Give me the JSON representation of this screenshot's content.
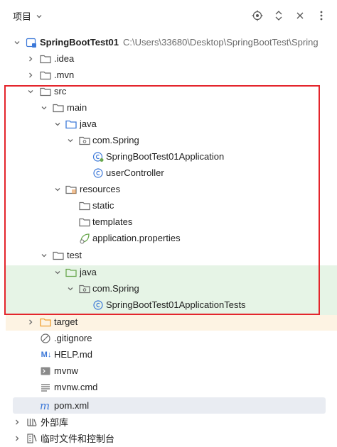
{
  "header": {
    "title": "项目",
    "icons": [
      "target-icon",
      "expand-collapse-icon",
      "close-icon",
      "more-icon"
    ]
  },
  "tree": [
    {
      "label": "SpringBootTest01",
      "path": "C:\\Users\\33680\\Desktop\\SpringBootTest\\Spring",
      "icon": "module-icon",
      "expanded": true,
      "level": 0
    },
    {
      "label": ".idea",
      "icon": "folder-icon",
      "expanded": false,
      "level": 1
    },
    {
      "label": ".mvn",
      "icon": "folder-icon",
      "expanded": false,
      "level": 1
    },
    {
      "label": "src",
      "icon": "folder-icon",
      "expanded": true,
      "level": 1
    },
    {
      "label": "main",
      "icon": "folder-icon",
      "expanded": true,
      "level": 2
    },
    {
      "label": "java",
      "icon": "source-folder-icon",
      "expanded": true,
      "level": 3
    },
    {
      "label": "com.Spring",
      "icon": "package-icon",
      "expanded": true,
      "level": 4
    },
    {
      "label": "SpringBootTest01Application",
      "icon": "spring-class-icon",
      "level": 5
    },
    {
      "label": "userController",
      "icon": "class-icon",
      "level": 5
    },
    {
      "label": "resources",
      "icon": "resources-folder-icon",
      "expanded": true,
      "level": 3
    },
    {
      "label": "static",
      "icon": "folder-icon",
      "level": 4
    },
    {
      "label": "templates",
      "icon": "folder-icon",
      "level": 4
    },
    {
      "label": "application.properties",
      "icon": "spring-properties-icon",
      "level": 4
    },
    {
      "label": "test",
      "icon": "folder-icon",
      "expanded": true,
      "level": 2
    },
    {
      "label": "java",
      "icon": "test-folder-icon",
      "expanded": true,
      "level": 3
    },
    {
      "label": "com.Spring",
      "icon": "package-icon",
      "expanded": true,
      "level": 4
    },
    {
      "label": "SpringBootTest01ApplicationTests",
      "icon": "class-icon",
      "level": 5
    },
    {
      "label": "target",
      "icon": "excluded-folder-icon",
      "expanded": false,
      "level": 1
    },
    {
      "label": ".gitignore",
      "icon": "ignore-icon",
      "level": 1
    },
    {
      "label": "HELP.md",
      "icon": "markdown-icon",
      "level": 1
    },
    {
      "label": "mvnw",
      "icon": "shell-icon",
      "level": 1
    },
    {
      "label": "mvnw.cmd",
      "icon": "text-icon",
      "level": 1
    },
    {
      "label": "pom.xml",
      "icon": "maven-icon",
      "level": 1
    },
    {
      "label": "外部库",
      "icon": "library-icon",
      "expanded": false,
      "level": 0
    },
    {
      "label": "临时文件和控制台",
      "icon": "scratches-icon",
      "expanded": false,
      "level": 0
    }
  ],
  "colors": {
    "highlight_box": "#e4252c",
    "test_folder": "#6aa84f",
    "source_folder": "#3c78d8",
    "excluded_folder": "#f0a030"
  }
}
